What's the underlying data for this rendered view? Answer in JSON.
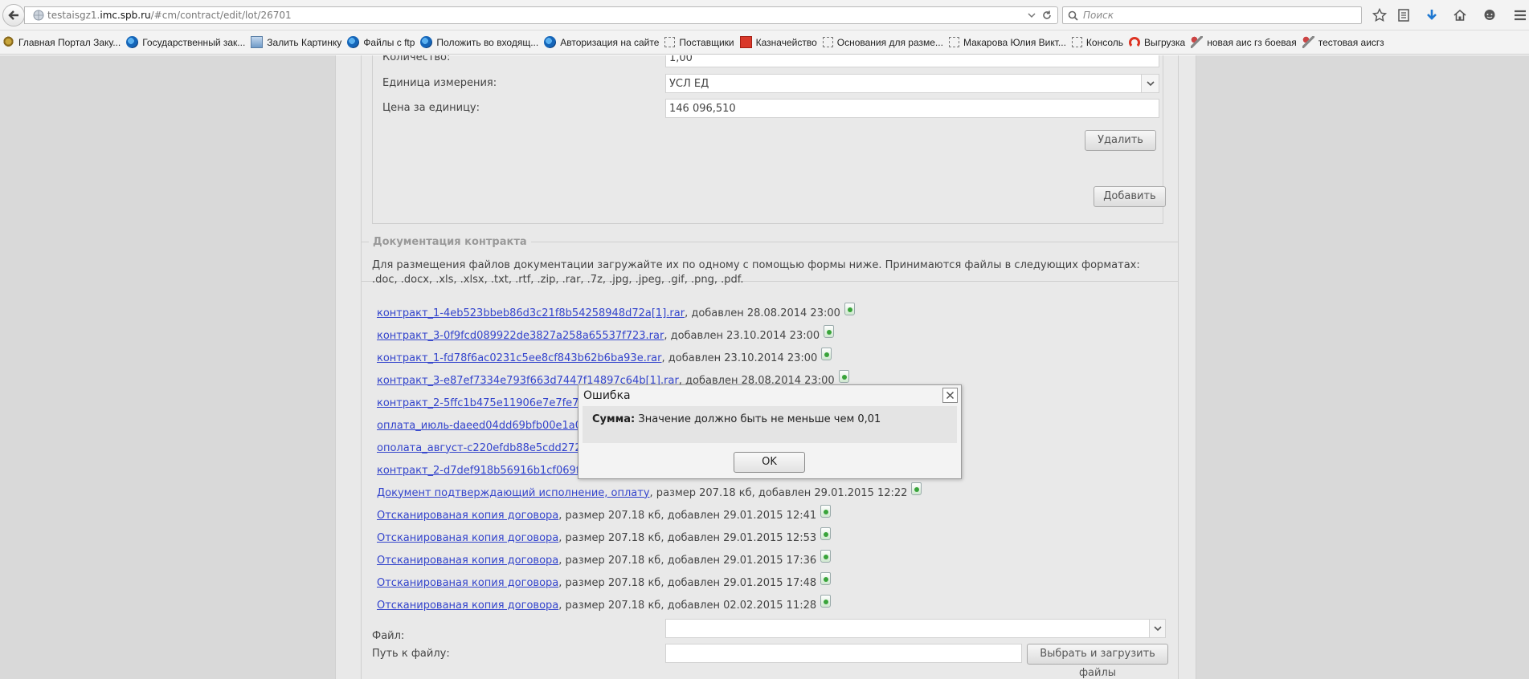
{
  "browser": {
    "url_prefix": "testaisgz1.",
    "url_host": "imc.spb.ru",
    "url_path": "/#cm/contract/edit/lot/26701",
    "search_placeholder": "Поиск"
  },
  "bookmarks": [
    {
      "label": "Главная Портал Заку...",
      "icon": "eagle-icon"
    },
    {
      "label": "Государственный зак...",
      "icon": "globe-icon"
    },
    {
      "label": "Залить Картинку",
      "icon": "image-icon"
    },
    {
      "label": "Файлы с ftp",
      "icon": "globe-icon"
    },
    {
      "label": "Положить во входящ...",
      "icon": "globe-icon"
    },
    {
      "label": "Авторизация на сайте",
      "icon": "globe-icon"
    },
    {
      "label": "Поставщики",
      "icon": "page-icon"
    },
    {
      "label": "Казначейство",
      "icon": "treasury-icon"
    },
    {
      "label": "Основания для разме...",
      "icon": "page-icon"
    },
    {
      "label": "Макарова Юлия Викт...",
      "icon": "page-icon"
    },
    {
      "label": "Консоль",
      "icon": "page-icon"
    },
    {
      "label": "Выгрузка",
      "icon": "arc-icon"
    },
    {
      "label": "новая аис гз боевая",
      "icon": "tools-icon"
    },
    {
      "label": "тестовая аисгз",
      "icon": "tools-icon"
    }
  ],
  "item": {
    "quantity_label": "Количество:",
    "quantity_value": "1,00",
    "unit_label": "Единица измерения:",
    "unit_value": "УСЛ ЕД",
    "price_label": "Цена за единицу:",
    "price_value": "146 096,510",
    "delete_button": "Удалить",
    "add_button": "Добавить"
  },
  "documents": {
    "legend": "Документация контракта",
    "intro": "Для размещения файлов документации загружайте их по одному с помощью формы ниже. Принимаются файлы в следующих форматах: .doc, .docx, .xls, .xlsx, .txt, .rtf, .zip, .rar, .7z, .jpg, .jpeg, .gif, .png, .pdf.",
    "files": [
      {
        "name": "контракт_1-4eb523bbeb86d3c21f8b54258948d72a[1].rar",
        "meta": ", добавлен 28.08.2014 23:00"
      },
      {
        "name": "контракт_3-0f9fcd089922de3827a258a65537f723.rar",
        "meta": ", добавлен 23.10.2014 23:00"
      },
      {
        "name": "контракт_1-fd78f6ac0231c5ee8cf843b62b6ba93e.rar",
        "meta": ", добавлен 23.10.2014 23:00"
      },
      {
        "name": "контракт_3-e87ef7334e793f663d7447f14897c64b[1].rar",
        "meta": ", добавлен 28.08.2014 23:00"
      },
      {
        "name": "контракт_2-5ffc1b475e11906e7e7fe7a",
        "meta": ""
      },
      {
        "name": "оплата_июль-daeed04dd69bfb00e1a0c",
        "meta": ""
      },
      {
        "name": "ополата_август-c220efdb88e5cdd2729",
        "meta": ""
      },
      {
        "name": "контракт_2-d7def918b56916b1cf069fb",
        "meta": ""
      },
      {
        "name": "Документ подтверждающий исполнение, оплату",
        "meta": ", размер 207.18 кб, добавлен 29.01.2015 12:22"
      },
      {
        "name": "Отсканированая копия договора",
        "meta": ", размер 207.18 кб, добавлен 29.01.2015 12:41"
      },
      {
        "name": "Отсканированая копия договора",
        "meta": ", размер 207.18 кб, добавлен 29.01.2015 12:53"
      },
      {
        "name": "Отсканированая копия договора",
        "meta": ", размер 207.18 кб, добавлен 29.01.2015 17:36"
      },
      {
        "name": "Отсканированая копия договора",
        "meta": ", размер 207.18 кб, добавлен 29.01.2015 17:48"
      },
      {
        "name": "Отсканированая копия договора",
        "meta": ", размер 207.18 кб, добавлен 02.02.2015 11:28"
      }
    ],
    "file_label": "Файл:",
    "path_label": "Путь к файлу:",
    "upload_button": "Выбрать и загрузить файлы"
  },
  "dialog": {
    "title": "Ошибка",
    "field": "Сумма:",
    "message": "Значение должно быть не меньше чем 0,01",
    "ok": "OK"
  }
}
